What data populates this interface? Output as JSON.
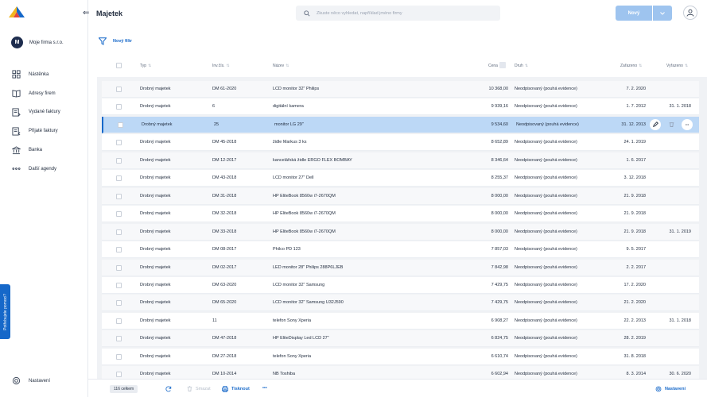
{
  "app": {
    "company_initial": "M",
    "company_name": "Moje firma s.r.o."
  },
  "nav": {
    "items": [
      {
        "label": "Nástěnka",
        "icon": "dashboard-icon"
      },
      {
        "label": "Adresy firem",
        "icon": "address-book-icon"
      },
      {
        "label": "Vydané faktury",
        "icon": "issued-invoice-icon"
      },
      {
        "label": "Přijaté faktury",
        "icon": "received-invoice-icon"
      },
      {
        "label": "Banka",
        "icon": "bank-icon"
      },
      {
        "label": "Další agendy",
        "icon": "more-icon"
      }
    ],
    "settings_label": "Nastavení",
    "help_label": "Potřebujete pomoci?"
  },
  "header": {
    "back_glyph": "⇐",
    "title": "Majetek",
    "search_placeholder": "Zkuste něco vyhledat, například jméno firmy",
    "new_button": "Nový"
  },
  "filter": {
    "label": "Nový filtr"
  },
  "table": {
    "columns": {
      "type": "Typ",
      "invnum": "Inv.čís.",
      "name": "Název",
      "price": "Cena",
      "kind": "Druh",
      "added": "Zařazeno",
      "removed": "Vyřazeno"
    },
    "rows": [
      {
        "type": "Drobný majetek",
        "invnum": "DM 61-2020",
        "name": "LCD monitor 32\" Philips",
        "price": "10 368,00",
        "kind": "Neodpisovaný (pouhá evidence)",
        "added": "7. 2. 2020",
        "removed": ""
      },
      {
        "type": "Drobný majetek",
        "invnum": "6",
        "name": "digitální kamera",
        "price": "9 939,16",
        "kind": "Neodpisovaný (pouhá evidence)",
        "added": "1. 7. 2012",
        "removed": "31. 1. 2018"
      },
      {
        "type": "Drobný majetek",
        "invnum": "25",
        "name": "monitor LG 29\"",
        "price": "9 534,60",
        "kind": "Neodpisovaný (pouhá evidence)",
        "added": "31. 12. 2013",
        "removed": "",
        "selected": true
      },
      {
        "type": "Drobný majetek",
        "invnum": "DM 45-2018",
        "name": "židle Markus 3 ks",
        "price": "8 652,89",
        "kind": "Neodpisovaný (pouhá evidence)",
        "added": "24. 1. 2019",
        "removed": ""
      },
      {
        "type": "Drobný majetek",
        "invnum": "DM 12-2017",
        "name": "kancelářská židle ERGO FLEX BOMBAY",
        "price": "8 346,64",
        "kind": "Neodpisovaný (pouhá evidence)",
        "added": "1. 6. 2017",
        "removed": ""
      },
      {
        "type": "Drobný majetek",
        "invnum": "DM 43-2018",
        "name": "LCD monitor 27\" Dell",
        "price": "8 255,37",
        "kind": "Neodpisovaný (pouhá evidence)",
        "added": "3. 12. 2018",
        "removed": ""
      },
      {
        "type": "Drobný majetek",
        "invnum": "DM 31-2018",
        "name": "HP EliteBook 8560w i7-2670QM",
        "price": "8 000,00",
        "kind": "Neodpisovaný (pouhá evidence)",
        "added": "21. 9. 2018",
        "removed": ""
      },
      {
        "type": "Drobný majetek",
        "invnum": "DM 32-2018",
        "name": "HP EliteBook 8560w i7-2670QM",
        "price": "8 000,00",
        "kind": "Neodpisovaný (pouhá evidence)",
        "added": "21. 9. 2018",
        "removed": ""
      },
      {
        "type": "Drobný majetek",
        "invnum": "DM 33-2018",
        "name": "HP EliteBook 8560w i7-2670QM",
        "price": "8 000,00",
        "kind": "Neodpisovaný (pouhá evidence)",
        "added": "21. 9. 2018",
        "removed": "31. 1. 2019"
      },
      {
        "type": "Drobný majetek",
        "invnum": "DM 08-2017",
        "name": "Philco PD 123",
        "price": "7 857,03",
        "kind": "Neodpisovaný (pouhá evidence)",
        "added": "9. 5. 2017",
        "removed": ""
      },
      {
        "type": "Drobný majetek",
        "invnum": "DM 02-2017",
        "name": "LED monitor 28\" Philips 288P6LJEB",
        "price": "7 842,98",
        "kind": "Neodpisovaný (pouhá evidence)",
        "added": "2. 2. 2017",
        "removed": ""
      },
      {
        "type": "Drobný majetek",
        "invnum": "DM 63-2020",
        "name": "LCD monitor 32\" Samsung",
        "price": "7 429,75",
        "kind": "Neodpisovaný (pouhá evidence)",
        "added": "17. 2. 2020",
        "removed": ""
      },
      {
        "type": "Drobný majetek",
        "invnum": "DM 65-2020",
        "name": "LCD monitor 32\" Samsung U32J590",
        "price": "7 429,75",
        "kind": "Neodpisovaný (pouhá evidence)",
        "added": "21. 2. 2020",
        "removed": ""
      },
      {
        "type": "Drobný majetek",
        "invnum": "11",
        "name": "telefon Sony Xperia",
        "price": "6 908,27",
        "kind": "Neodpisovaný (pouhá evidence)",
        "added": "22. 2. 2013",
        "removed": "31. 1. 2018"
      },
      {
        "type": "Drobný majetek",
        "invnum": "DM 47-2018",
        "name": "HP EliteDisplay Led LCD 27\"",
        "price": "6 824,75",
        "kind": "Neodpisovaný (pouhá evidence)",
        "added": "28. 2. 2019",
        "removed": ""
      },
      {
        "type": "Drobný majetek",
        "invnum": "DM 27-2018",
        "name": "telefon Sony Xperia",
        "price": "6 610,74",
        "kind": "Neodpisovaný (pouhá evidence)",
        "added": "31. 8. 2018",
        "removed": ""
      },
      {
        "type": "Drobný majetek",
        "invnum": "DM 10-2014",
        "name": "NB Toshiba",
        "price": "6 602,94",
        "kind": "Neodpisovaný (pouhá evidence)",
        "added": "8. 3. 2014",
        "removed": "30. 6. 2020"
      }
    ]
  },
  "footer": {
    "count": "116 celkem",
    "delete_label": "Smazat",
    "print_label": "Tisknout",
    "more_glyph": "•••",
    "settings_label": "Nastavení"
  },
  "colors": {
    "accent": "#1668c9",
    "selected_row": "#bcd8f6",
    "new_button": "#9ec4ef"
  }
}
